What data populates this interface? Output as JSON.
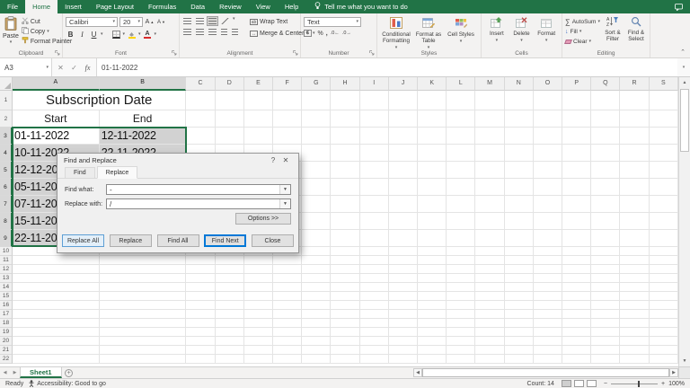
{
  "colors": {
    "excel_green": "#217346",
    "selection_fill": "#d2d2d2",
    "focus_blue": "#0078d7"
  },
  "tab_bar": {
    "tabs": [
      "File",
      "Home",
      "Insert",
      "Page Layout",
      "Formulas",
      "Data",
      "Review",
      "View",
      "Help"
    ],
    "active": "Home",
    "tell_me": "Tell me what you want to do"
  },
  "ribbon": {
    "clipboard": {
      "label": "Clipboard",
      "paste": "Paste",
      "cut": "Cut",
      "copy": "Copy",
      "format_painter": "Format Painter"
    },
    "font": {
      "label": "Font",
      "family": "Calibri",
      "size": "20",
      "bold": "B",
      "italic": "I",
      "underline": "U"
    },
    "alignment": {
      "label": "Alignment",
      "wrap_text": "Wrap Text",
      "merge_center": "Merge & Center"
    },
    "number": {
      "label": "Number",
      "format": "Text"
    },
    "styles": {
      "label": "Styles",
      "conditional": "Conditional Formatting",
      "format_table": "Format as Table",
      "cell_styles": "Cell Styles"
    },
    "cells": {
      "label": "Cells",
      "insert": "Insert",
      "delete": "Delete",
      "format": "Format"
    },
    "editing": {
      "label": "Editing",
      "autosum": "AutoSum",
      "fill": "Fill",
      "clear": "Clear",
      "sort_filter": "Sort & Filter",
      "find_select": "Find & Select"
    }
  },
  "formula_bar": {
    "name_box": "A3",
    "value": "01-11-2022"
  },
  "grid": {
    "col_headers": [
      "A",
      "B",
      "C",
      "D",
      "E",
      "F",
      "G",
      "H",
      "I",
      "J",
      "K",
      "L",
      "M",
      "N",
      "O",
      "P",
      "Q",
      "R",
      "S"
    ],
    "row_count": 22,
    "title": "Subscription Date",
    "col_a_header": "Start",
    "col_b_header": "End",
    "rows": [
      {
        "n": 3,
        "a": "01-11-2022",
        "b": "12-11-2022"
      },
      {
        "n": 4,
        "a": "10-11-2022",
        "b": "22-11-2022"
      },
      {
        "n": 5,
        "a": "12-12-2022",
        "b": ""
      },
      {
        "n": 6,
        "a": "05-11-2022",
        "b": ""
      },
      {
        "n": 7,
        "a": "07-11-2022",
        "b": ""
      },
      {
        "n": 8,
        "a": "15-11-2022",
        "b": ""
      },
      {
        "n": 9,
        "a": "22-11-2022",
        "b": ""
      }
    ]
  },
  "dialog": {
    "title": "Find and Replace",
    "tabs": [
      "Find",
      "Replace"
    ],
    "active_tab": "Replace",
    "find_label": "Find what:",
    "find_value": "-",
    "replace_label": "Replace with:",
    "replace_value": "/",
    "options_button": "Options >>",
    "buttons": [
      "Replace All",
      "Replace",
      "Find All",
      "Find Next",
      "Close"
    ]
  },
  "sheet_bar": {
    "sheet1": "Sheet1"
  },
  "status_bar": {
    "ready": "Ready",
    "accessibility": "Accessibility: Good to go",
    "count": "Count: 14",
    "zoom_level": "100%"
  }
}
